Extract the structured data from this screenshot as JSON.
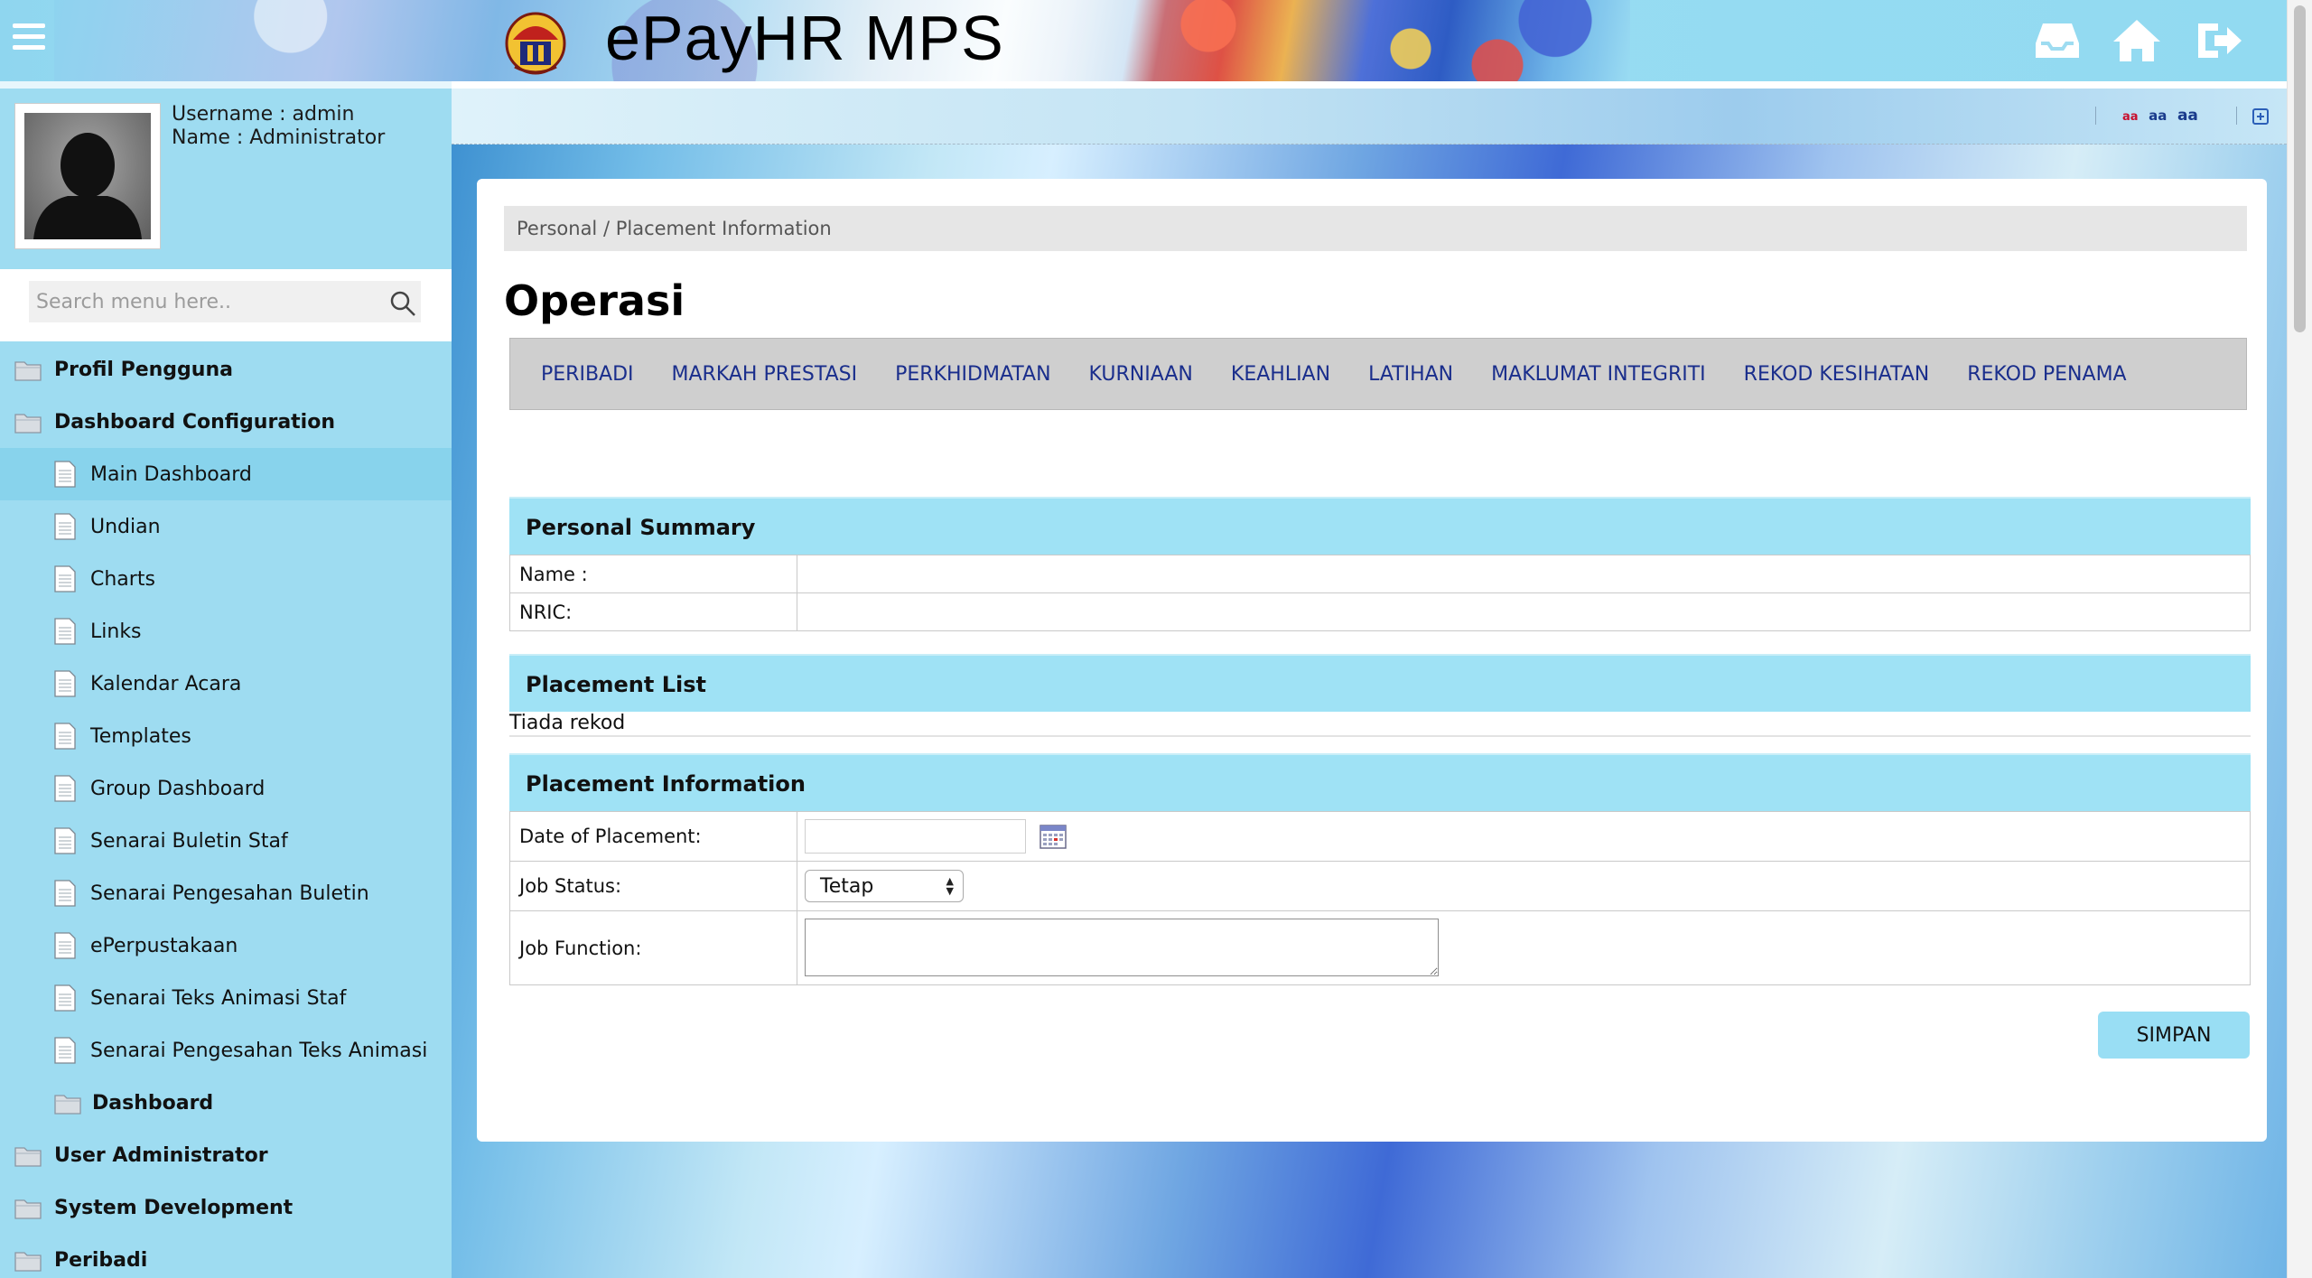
{
  "header": {
    "app_title": "ePayHR MPS",
    "icons": [
      "menu-icon",
      "inbox-icon",
      "home-icon",
      "logout-icon"
    ]
  },
  "profile": {
    "username_line": "Username : admin",
    "name_line": "Name : Administrator"
  },
  "search": {
    "placeholder": "Search menu here.."
  },
  "menu": {
    "items": [
      {
        "label": "Profil Pengguna",
        "level": "top",
        "icon": "folder-icon"
      },
      {
        "label": "Dashboard Configuration",
        "level": "top",
        "icon": "folder-icon"
      },
      {
        "label": "Main Dashboard",
        "level": "sub",
        "icon": "document-icon",
        "active": true
      },
      {
        "label": "Undian",
        "level": "sub",
        "icon": "document-icon"
      },
      {
        "label": "Charts",
        "level": "sub",
        "icon": "document-icon"
      },
      {
        "label": "Links",
        "level": "sub",
        "icon": "document-icon"
      },
      {
        "label": "Kalendar Acara",
        "level": "sub",
        "icon": "document-icon"
      },
      {
        "label": "Templates",
        "level": "sub",
        "icon": "document-icon"
      },
      {
        "label": "Group Dashboard",
        "level": "sub",
        "icon": "document-icon"
      },
      {
        "label": "Senarai Buletin Staf",
        "level": "sub",
        "icon": "document-icon"
      },
      {
        "label": "Senarai Pengesahan Buletin",
        "level": "sub",
        "icon": "document-icon"
      },
      {
        "label": "ePerpustakaan",
        "level": "sub",
        "icon": "document-icon"
      },
      {
        "label": "Senarai Teks Animasi Staf",
        "level": "sub",
        "icon": "document-icon"
      },
      {
        "label": "Senarai Pengesahan Teks Animasi",
        "level": "sub",
        "icon": "document-icon"
      },
      {
        "label": "Dashboard",
        "level": "sub",
        "icon": "folder-icon",
        "bold": true
      },
      {
        "label": "User Administrator",
        "level": "top",
        "icon": "folder-icon"
      },
      {
        "label": "System Development",
        "level": "top",
        "icon": "folder-icon"
      },
      {
        "label": "Peribadi",
        "level": "top",
        "icon": "folder-icon"
      }
    ]
  },
  "toolbar": {
    "font_small": "aa",
    "font_medium": "aa",
    "font_large": "aa"
  },
  "main": {
    "breadcrumb": "Personal / Placement Information",
    "title": "Operasi",
    "tabs": [
      "PERIBADI",
      "MARKAH PRESTASI",
      "PERKHIDMATAN",
      "KURNIAAN",
      "KEAHLIAN",
      "LATIHAN",
      "MAKLUMAT INTEGRITI",
      "REKOD KESIHATAN",
      "REKOD PENAMA"
    ],
    "personal_summary": {
      "heading": "Personal Summary",
      "name_label": "Name :",
      "name_value": "",
      "nric_label": "NRIC:",
      "nric_value": ""
    },
    "placement_list": {
      "heading": "Placement List",
      "empty_text": "Tiada rekod"
    },
    "placement_information": {
      "heading": "Placement Information",
      "date_label": "Date of Placement:",
      "date_value": "",
      "job_status_label": "Job Status:",
      "job_status_value": "Tetap",
      "job_function_label": "Job Function:",
      "job_function_value": ""
    },
    "save_label": "SIMPAN"
  }
}
